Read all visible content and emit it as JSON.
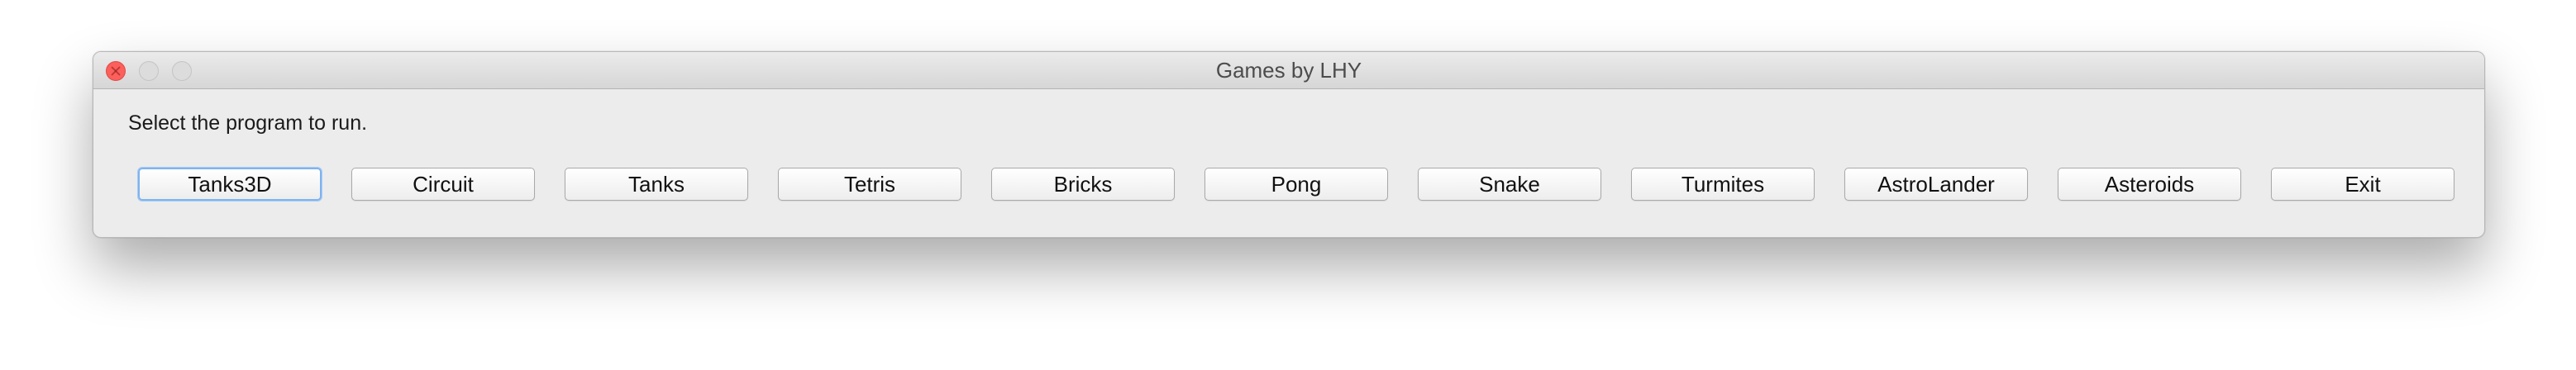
{
  "window": {
    "title": "Games by LHY"
  },
  "content": {
    "prompt": "Select the program to run."
  },
  "buttons": [
    {
      "label": "Tanks3D",
      "focused": true
    },
    {
      "label": "Circuit"
    },
    {
      "label": "Tanks"
    },
    {
      "label": "Tetris"
    },
    {
      "label": "Bricks"
    },
    {
      "label": "Pong"
    },
    {
      "label": "Snake"
    },
    {
      "label": "Turmites"
    },
    {
      "label": "AstroLander"
    },
    {
      "label": "Asteroids"
    },
    {
      "label": "Exit"
    }
  ],
  "colors": {
    "close": "#fc605c",
    "focus_ring": "#7fb3ef",
    "window_bg": "#ececec"
  }
}
